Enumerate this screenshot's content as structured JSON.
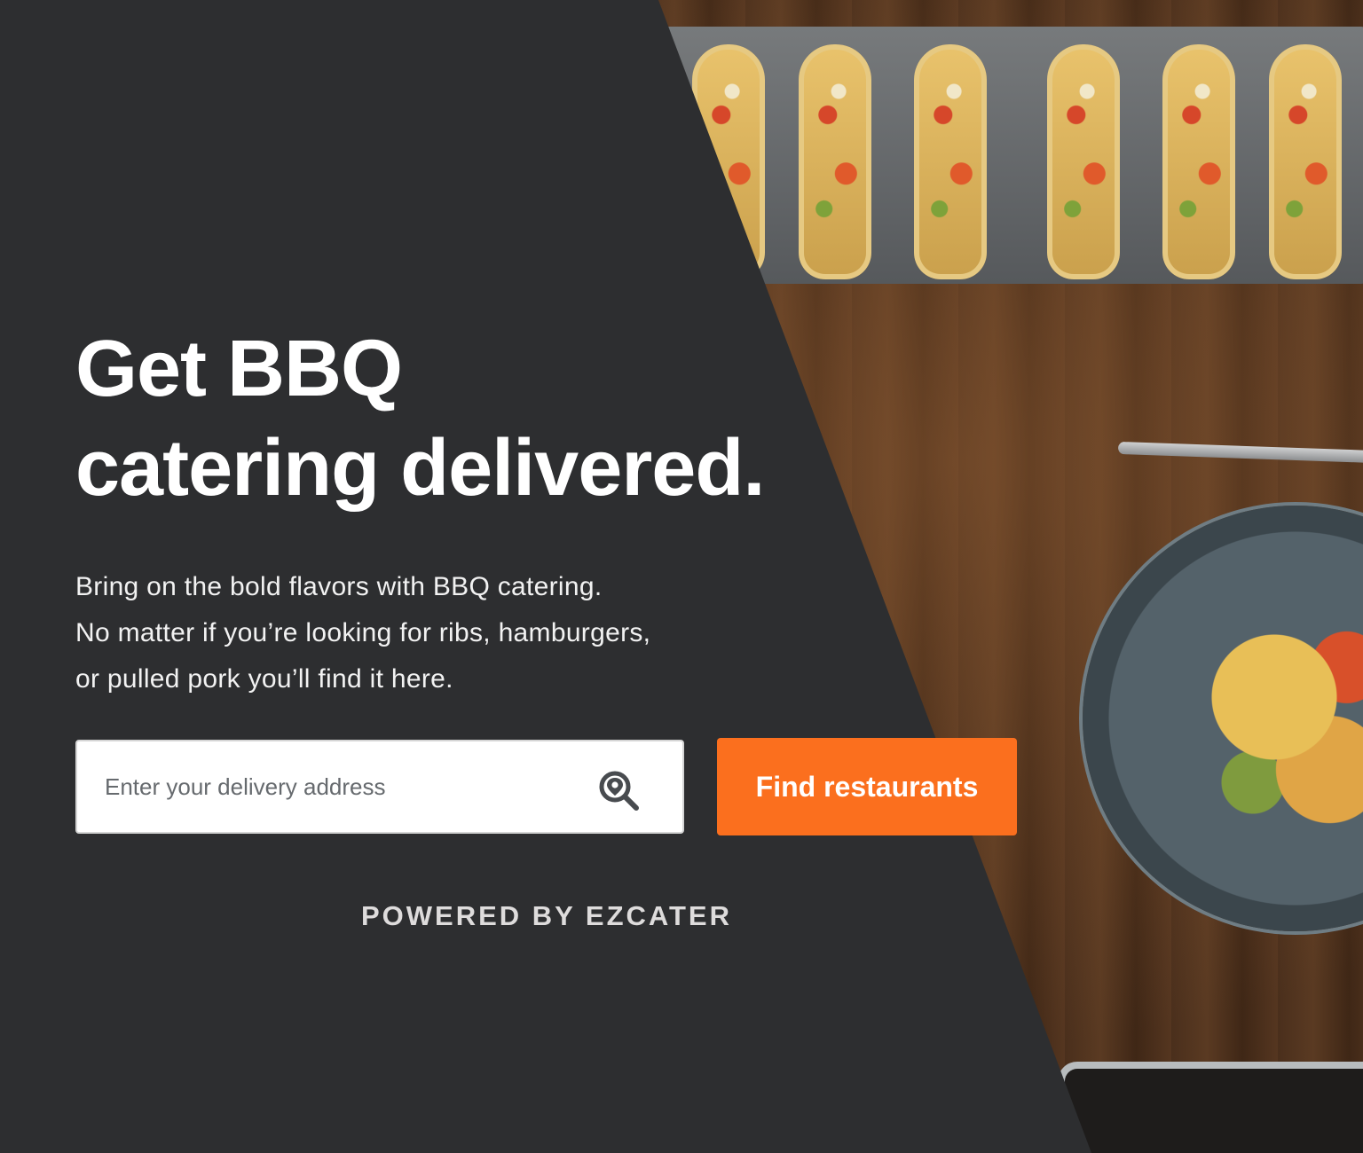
{
  "hero": {
    "headline_line1": "Get BBQ",
    "headline_line2": "catering delivered.",
    "subtext_line1": "Bring on the bold flavors with BBQ catering.",
    "subtext_line2": "No matter if you’re looking for ribs, hamburgers,",
    "subtext_line3": "or pulled pork you’ll find it here."
  },
  "search": {
    "placeholder": "Enter your delivery address",
    "value": "",
    "icon": "location-search-icon",
    "button_label": "Find restaurants"
  },
  "footer": {
    "powered_by": "POWERED BY EZCATER"
  },
  "colors": {
    "background": "#2d2e30",
    "accent": "#fb6f1e",
    "text": "#ffffff"
  }
}
